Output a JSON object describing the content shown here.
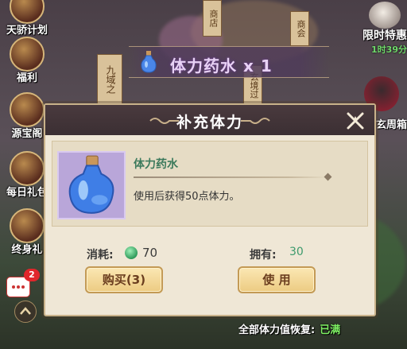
{
  "left_menu": {
    "items": [
      {
        "label": "天骄计划",
        "icon": "scroll-icon"
      },
      {
        "label": "福利",
        "icon": "gift-scroll-icon"
      },
      {
        "label": "源宝阁",
        "icon": "pavilion-icon"
      },
      {
        "label": "每日礼包",
        "icon": "gift-box-icon"
      },
      {
        "label": "终身礼",
        "icon": "chest-icon"
      }
    ]
  },
  "right_menu": {
    "limited_offer_label": "限时特惠",
    "limited_offer_countdown": "1时39分",
    "character_label": "玄周箱"
  },
  "background_signs": [
    "商店",
    "商会",
    "九域之",
    "玄境过"
  ],
  "banner": {
    "item_text": "体力药水 x 1"
  },
  "dialog": {
    "title": "补充体力",
    "item": {
      "name": "体力药水",
      "description": "使用后获得50点体力。"
    },
    "cost_label": "消耗:",
    "cost_value": "70",
    "owned_label": "拥有:",
    "owned_value": "30",
    "buy_button": "购买(3)",
    "use_button": "使 用"
  },
  "footer": {
    "recover_label": "全部体力值恢复:",
    "recover_status": "已满"
  },
  "chat": {
    "badge_count": "2"
  },
  "colors": {
    "title_bar": "#3b2f33",
    "dialog_bg": "#efe7d6",
    "item_name": "#3c7a5c",
    "status_full": "#7ff064",
    "badge": "#e0262b"
  }
}
